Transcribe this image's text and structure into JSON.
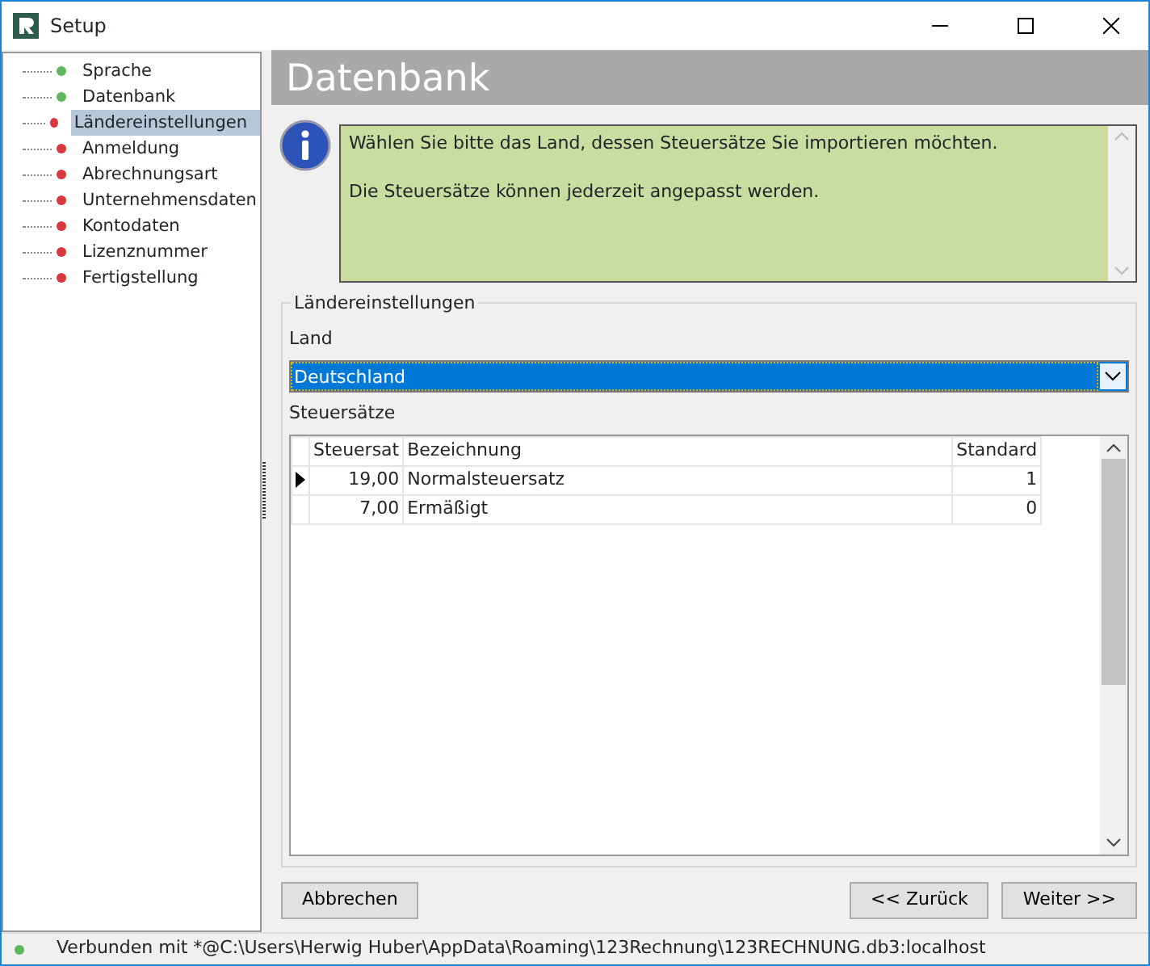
{
  "window": {
    "title": "Setup"
  },
  "steps": [
    {
      "label": "Sprache",
      "color": "#5cb85c",
      "selected": false
    },
    {
      "label": "Datenbank",
      "color": "#5cb85c",
      "selected": false
    },
    {
      "label": "Ländereinstellungen",
      "color": "#d9363e",
      "selected": true
    },
    {
      "label": "Anmeldung",
      "color": "#d9363e",
      "selected": false
    },
    {
      "label": "Abrechnungsart",
      "color": "#d9363e",
      "selected": false
    },
    {
      "label": "Unternehmensdaten",
      "color": "#d9363e",
      "selected": false
    },
    {
      "label": "Kontodaten",
      "color": "#d9363e",
      "selected": false
    },
    {
      "label": "Lizenznummer",
      "color": "#d9363e",
      "selected": false
    },
    {
      "label": "Fertigstellung",
      "color": "#d9363e",
      "selected": false
    }
  ],
  "page": {
    "heading": "Datenbank",
    "info": [
      "Wählen Sie bitte das Land, dessen Steuersätze Sie importieren möchten.",
      "Die Steuersätze können jederzeit angepasst werden."
    ],
    "group": {
      "title": "Ländereinstellungen",
      "country_label": "Land",
      "country": "Deutschland",
      "rates_label": "Steuersätze",
      "table": {
        "columns": [
          "Steuersat",
          "Bezeichnung",
          "Standard"
        ],
        "rows": [
          {
            "cells": [
              "19,00",
              "Normalsteuersatz",
              "1"
            ],
            "current": true
          },
          {
            "cells": [
              "7,00",
              "Ermäßigt",
              "0"
            ],
            "current": false
          }
        ]
      }
    }
  },
  "buttons": {
    "cancel": "Abbrechen",
    "back": "<< Zurück",
    "next": "Weiter >>"
  },
  "status_bar": {
    "text": "Verbunden mit *@C:\\Users\\Herwig Huber\\AppData\\Roaming\\123Rechnung\\123RECHNUNG.db3:localhost",
    "color": "#5cb85c"
  }
}
